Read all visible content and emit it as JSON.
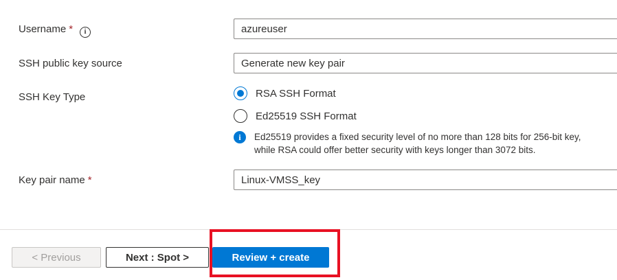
{
  "form": {
    "username": {
      "label": "Username",
      "required_mark": "*",
      "info_glyph": "i",
      "value": "azureuser"
    },
    "ssh_public_key_source": {
      "label": "SSH public key source",
      "value": "Generate new key pair"
    },
    "ssh_key_type": {
      "label": "SSH Key Type",
      "options": [
        {
          "label": "RSA SSH Format",
          "selected": true
        },
        {
          "label": "Ed25519 SSH Format",
          "selected": false
        }
      ],
      "info_glyph": "i",
      "info_line1": "Ed25519 provides a fixed security level of no more than 128 bits for 256-bit key,",
      "info_line2": "while RSA could offer better security with keys longer than 3072 bits."
    },
    "key_pair_name": {
      "label": "Key pair name",
      "required_mark": "*",
      "value": "Linux-VMSS_key"
    }
  },
  "footer": {
    "previous_label": "< Previous",
    "next_label": "Next : Spot >",
    "review_label": "Review + create"
  },
  "colors": {
    "accent": "#0078d4",
    "required": "#a4262c",
    "highlight": "#e81123"
  }
}
